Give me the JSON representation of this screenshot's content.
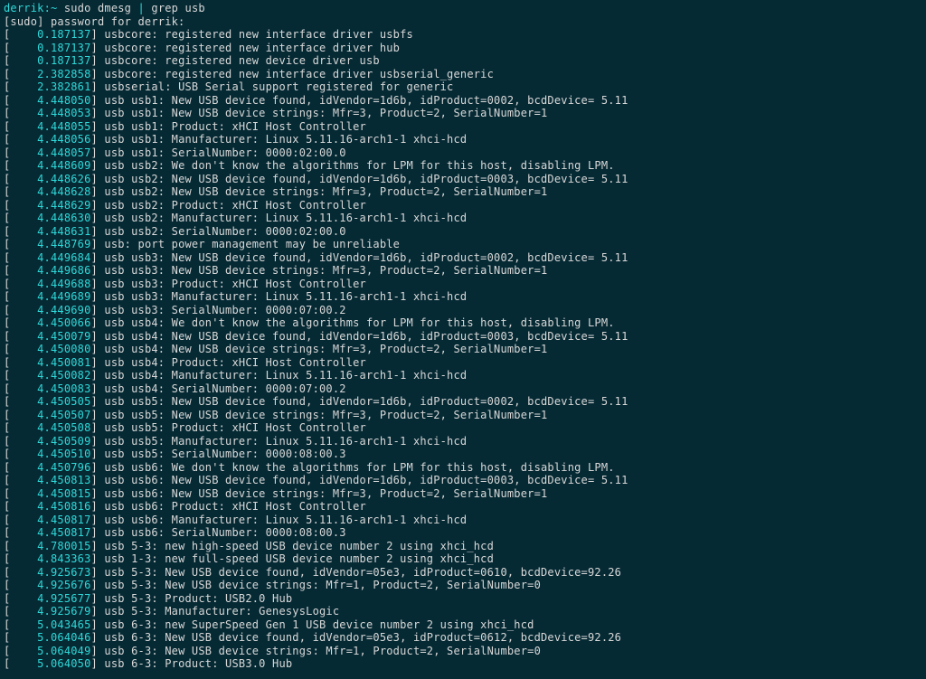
{
  "prompt": {
    "user": "derrik",
    "host": "",
    "path": "~ ",
    "command": "sudo dmesg ",
    "pipe": "|",
    "command2": " grep usb"
  },
  "sudo_prompt": "[sudo] password for derrik:",
  "lines": [
    {
      "t": "0.187137",
      "m": "usbcore: registered new interface driver usbfs"
    },
    {
      "t": "0.187137",
      "m": "usbcore: registered new interface driver hub"
    },
    {
      "t": "0.187137",
      "m": "usbcore: registered new device driver usb"
    },
    {
      "t": "2.382858",
      "m": "usbcore: registered new interface driver usbserial_generic"
    },
    {
      "t": "2.382861",
      "m": "usbserial: USB Serial support registered for generic"
    },
    {
      "t": "4.448050",
      "m": "usb usb1: New USB device found, idVendor=1d6b, idProduct=0002, bcdDevice= 5.11"
    },
    {
      "t": "4.448053",
      "m": "usb usb1: New USB device strings: Mfr=3, Product=2, SerialNumber=1"
    },
    {
      "t": "4.448055",
      "m": "usb usb1: Product: xHCI Host Controller"
    },
    {
      "t": "4.448056",
      "m": "usb usb1: Manufacturer: Linux 5.11.16-arch1-1 xhci-hcd"
    },
    {
      "t": "4.448057",
      "m": "usb usb1: SerialNumber: 0000:02:00.0"
    },
    {
      "t": "4.448609",
      "m": "usb usb2: We don't know the algorithms for LPM for this host, disabling LPM."
    },
    {
      "t": "4.448626",
      "m": "usb usb2: New USB device found, idVendor=1d6b, idProduct=0003, bcdDevice= 5.11"
    },
    {
      "t": "4.448628",
      "m": "usb usb2: New USB device strings: Mfr=3, Product=2, SerialNumber=1"
    },
    {
      "t": "4.448629",
      "m": "usb usb2: Product: xHCI Host Controller"
    },
    {
      "t": "4.448630",
      "m": "usb usb2: Manufacturer: Linux 5.11.16-arch1-1 xhci-hcd"
    },
    {
      "t": "4.448631",
      "m": "usb usb2: SerialNumber: 0000:02:00.0"
    },
    {
      "t": "4.448769",
      "m": "usb: port power management may be unreliable"
    },
    {
      "t": "4.449684",
      "m": "usb usb3: New USB device found, idVendor=1d6b, idProduct=0002, bcdDevice= 5.11"
    },
    {
      "t": "4.449686",
      "m": "usb usb3: New USB device strings: Mfr=3, Product=2, SerialNumber=1"
    },
    {
      "t": "4.449688",
      "m": "usb usb3: Product: xHCI Host Controller"
    },
    {
      "t": "4.449689",
      "m": "usb usb3: Manufacturer: Linux 5.11.16-arch1-1 xhci-hcd"
    },
    {
      "t": "4.449690",
      "m": "usb usb3: SerialNumber: 0000:07:00.2"
    },
    {
      "t": "4.450066",
      "m": "usb usb4: We don't know the algorithms for LPM for this host, disabling LPM."
    },
    {
      "t": "4.450079",
      "m": "usb usb4: New USB device found, idVendor=1d6b, idProduct=0003, bcdDevice= 5.11"
    },
    {
      "t": "4.450080",
      "m": "usb usb4: New USB device strings: Mfr=3, Product=2, SerialNumber=1"
    },
    {
      "t": "4.450081",
      "m": "usb usb4: Product: xHCI Host Controller"
    },
    {
      "t": "4.450082",
      "m": "usb usb4: Manufacturer: Linux 5.11.16-arch1-1 xhci-hcd"
    },
    {
      "t": "4.450083",
      "m": "usb usb4: SerialNumber: 0000:07:00.2"
    },
    {
      "t": "4.450505",
      "m": "usb usb5: New USB device found, idVendor=1d6b, idProduct=0002, bcdDevice= 5.11"
    },
    {
      "t": "4.450507",
      "m": "usb usb5: New USB device strings: Mfr=3, Product=2, SerialNumber=1"
    },
    {
      "t": "4.450508",
      "m": "usb usb5: Product: xHCI Host Controller"
    },
    {
      "t": "4.450509",
      "m": "usb usb5: Manufacturer: Linux 5.11.16-arch1-1 xhci-hcd"
    },
    {
      "t": "4.450510",
      "m": "usb usb5: SerialNumber: 0000:08:00.3"
    },
    {
      "t": "4.450796",
      "m": "usb usb6: We don't know the algorithms for LPM for this host, disabling LPM."
    },
    {
      "t": "4.450813",
      "m": "usb usb6: New USB device found, idVendor=1d6b, idProduct=0003, bcdDevice= 5.11"
    },
    {
      "t": "4.450815",
      "m": "usb usb6: New USB device strings: Mfr=3, Product=2, SerialNumber=1"
    },
    {
      "t": "4.450816",
      "m": "usb usb6: Product: xHCI Host Controller"
    },
    {
      "t": "4.450817",
      "m": "usb usb6: Manufacturer: Linux 5.11.16-arch1-1 xhci-hcd"
    },
    {
      "t": "4.450817",
      "m": "usb usb6: SerialNumber: 0000:08:00.3"
    },
    {
      "t": "4.780015",
      "m": "usb 5-3: new high-speed USB device number 2 using xhci_hcd"
    },
    {
      "t": "4.843363",
      "m": "usb 1-3: new full-speed USB device number 2 using xhci_hcd"
    },
    {
      "t": "4.925673",
      "m": "usb 5-3: New USB device found, idVendor=05e3, idProduct=0610, bcdDevice=92.26"
    },
    {
      "t": "4.925676",
      "m": "usb 5-3: New USB device strings: Mfr=1, Product=2, SerialNumber=0"
    },
    {
      "t": "4.925677",
      "m": "usb 5-3: Product: USB2.0 Hub"
    },
    {
      "t": "4.925679",
      "m": "usb 5-3: Manufacturer: GenesysLogic"
    },
    {
      "t": "5.043465",
      "m": "usb 6-3: new SuperSpeed Gen 1 USB device number 2 using xhci_hcd"
    },
    {
      "t": "5.064046",
      "m": "usb 6-3: New USB device found, idVendor=05e3, idProduct=0612, bcdDevice=92.26"
    },
    {
      "t": "5.064049",
      "m": "usb 6-3: New USB device strings: Mfr=1, Product=2, SerialNumber=0"
    },
    {
      "t": "5.064050",
      "m": "usb 6-3: Product: USB3.0 Hub"
    }
  ]
}
